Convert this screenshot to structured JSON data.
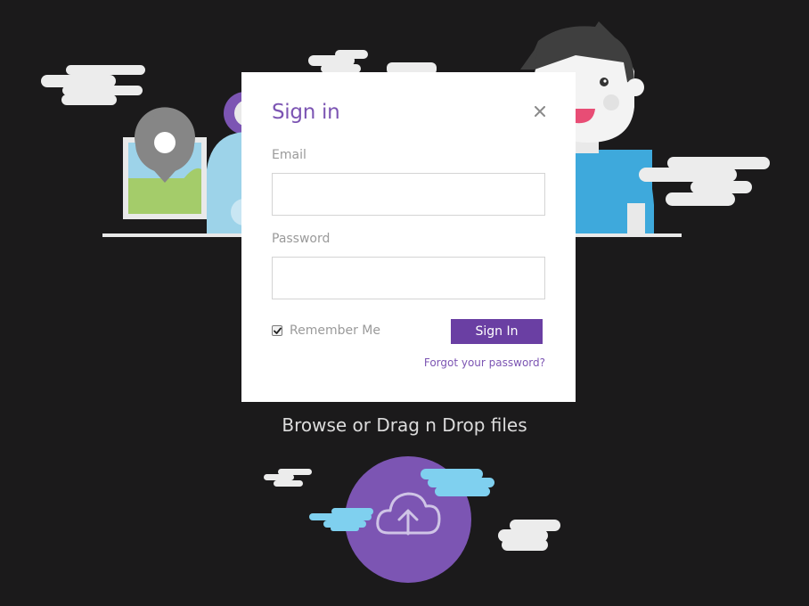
{
  "modal": {
    "title": "Sign in",
    "email_label": "Email",
    "email_value": "",
    "password_label": "Password",
    "password_value": "",
    "remember_label": "Remember Me",
    "remember_checked": true,
    "signin_label": "Sign In",
    "forgot_label": "Forgot your password?"
  },
  "upload": {
    "browse_text": "Browse or Drag n Drop files"
  },
  "colors": {
    "background": "#1b1a1b",
    "accent": "#7c55b3",
    "button": "#6a3fa3",
    "cloud_blue": "#7fd0ef",
    "cloud_white": "#f2f2f2"
  },
  "icons": {
    "close": "close-icon",
    "upload": "cloud-upload-icon",
    "map_pin": "map-pin-icon",
    "checkbox": "checkmark-icon"
  }
}
